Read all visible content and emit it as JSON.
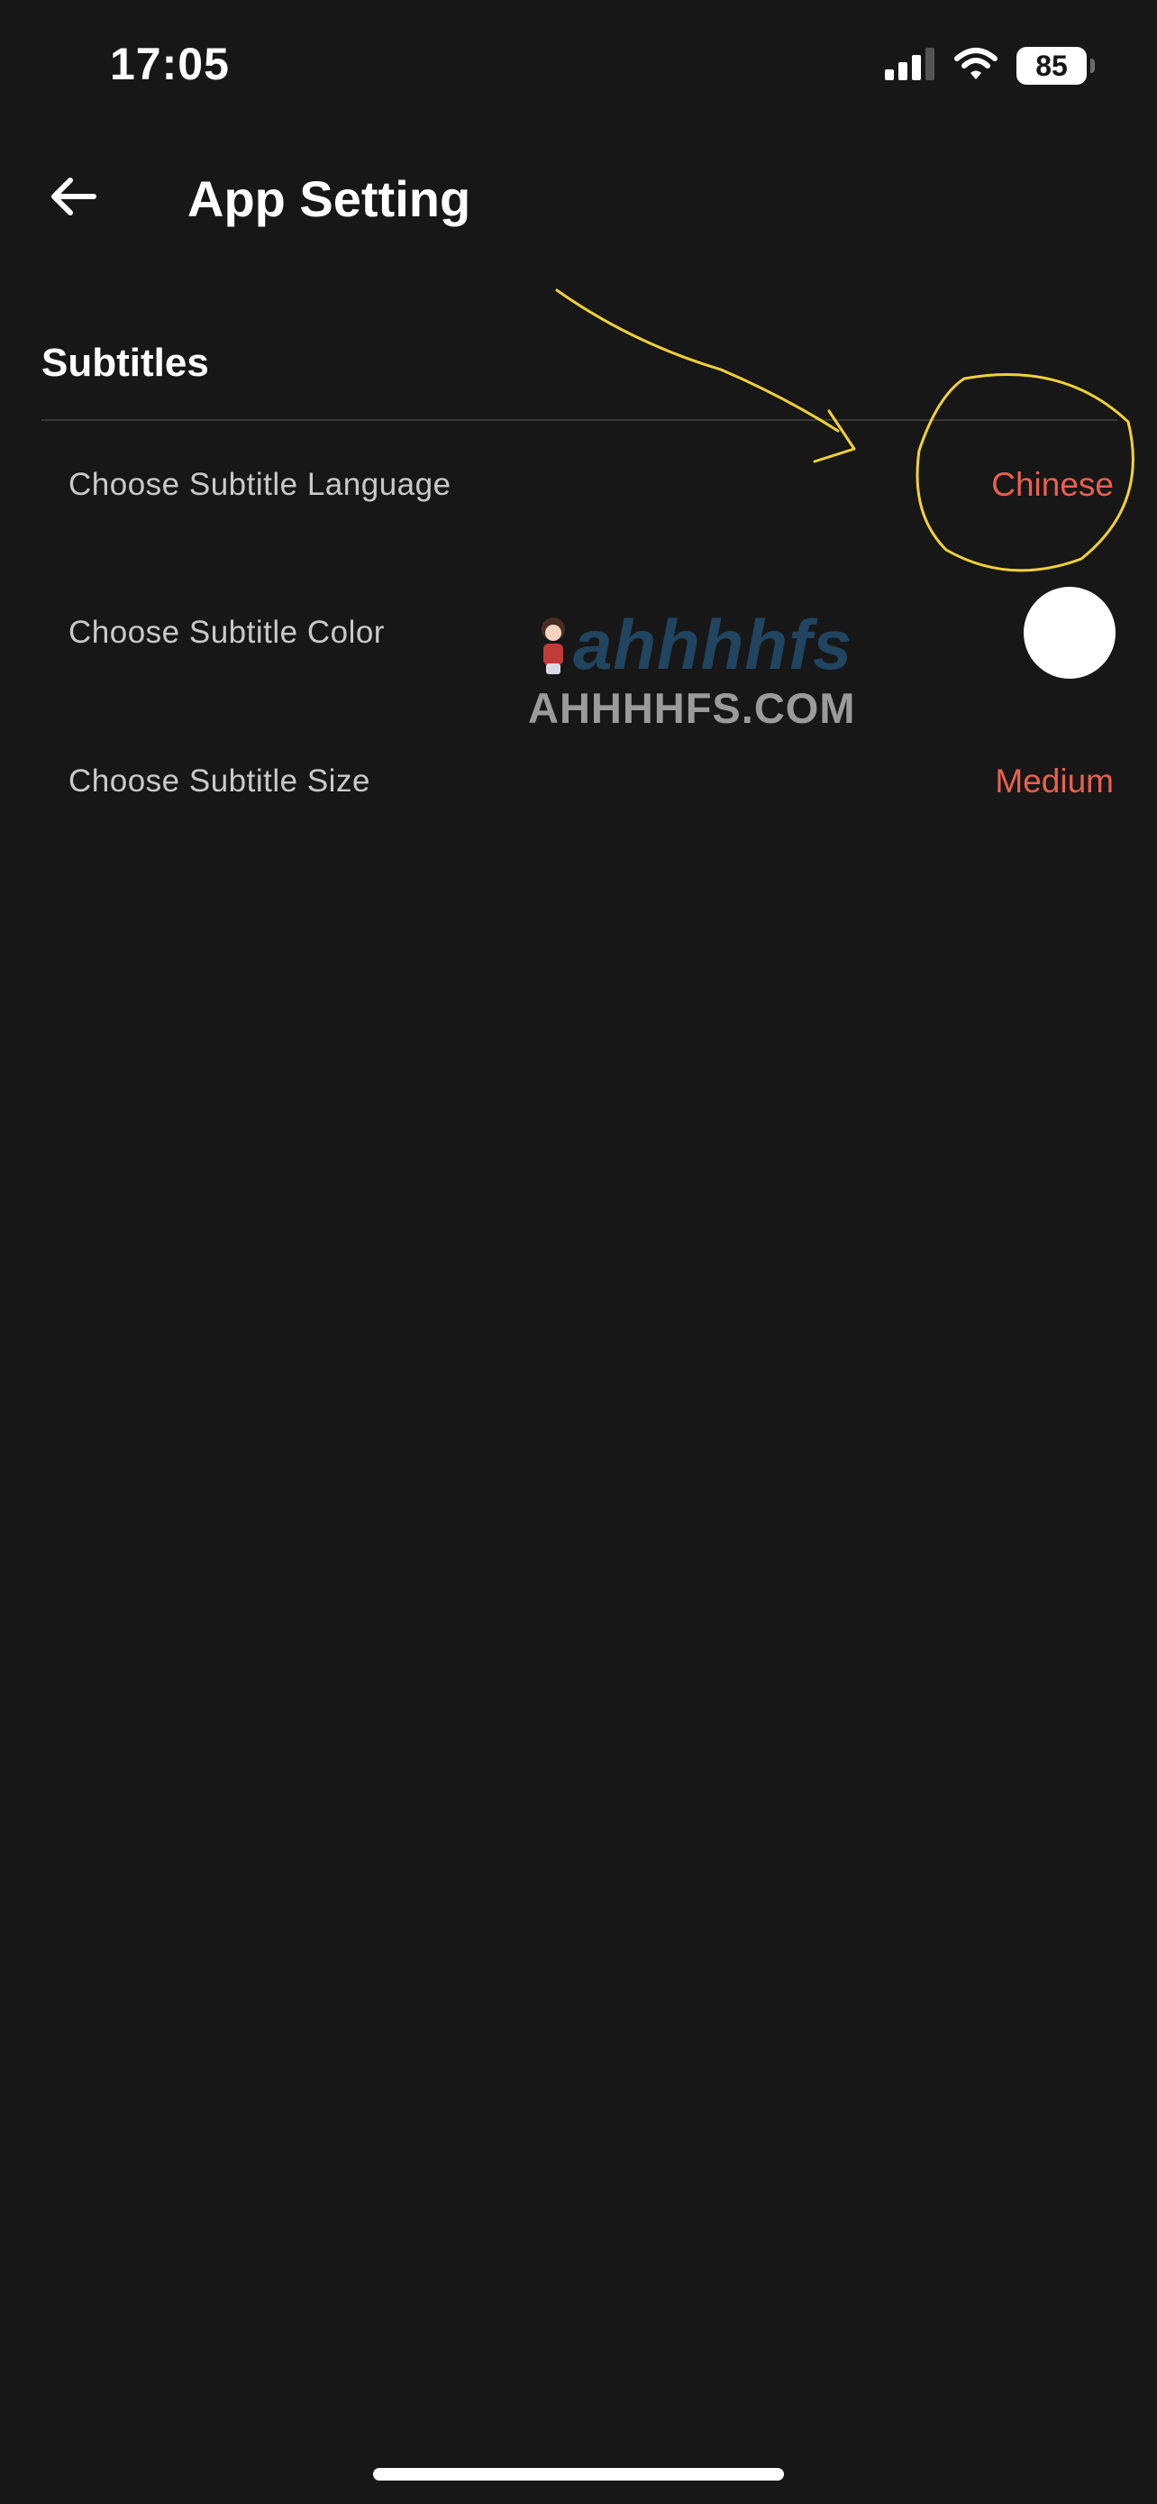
{
  "status_bar": {
    "time": "17:05",
    "battery_level": "85",
    "icons": [
      "cellular-signal-icon",
      "wifi-icon",
      "battery-icon"
    ]
  },
  "header": {
    "back_icon": "arrow-left-icon",
    "title": "App Setting"
  },
  "section": {
    "title": "Subtitles",
    "items": [
      {
        "label": "Choose Subtitle Language",
        "value": "Chinese"
      },
      {
        "label": "Choose Subtitle Color",
        "value_color": "#ffffff"
      },
      {
        "label": "Choose Subtitle Size",
        "value": "Medium"
      }
    ]
  },
  "watermark": {
    "logo": "ahhhhfs",
    "text": "AHHHHFS.COM"
  },
  "colors": {
    "background": "#171717",
    "accent": "#e8614f",
    "annotation": "#f1d13a",
    "divider": "#3a3a3a"
  }
}
